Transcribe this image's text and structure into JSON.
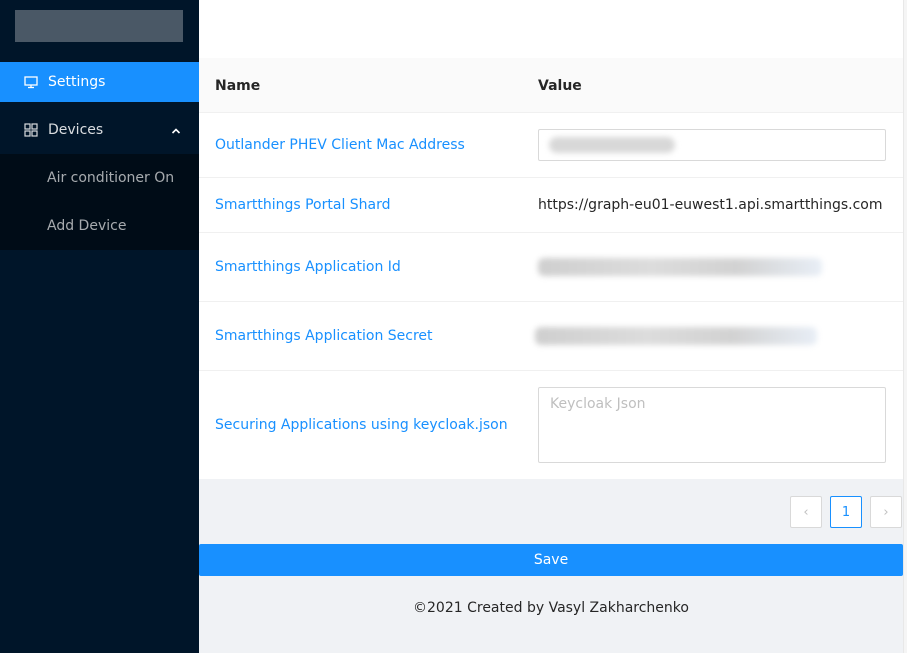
{
  "sidebar": {
    "items": [
      {
        "label": "Settings",
        "icon": "desktop-icon"
      },
      {
        "label": "Devices",
        "icon": "appstore-icon"
      }
    ],
    "subitems": [
      {
        "label": "Air conditioner On"
      },
      {
        "label": "Add Device"
      }
    ]
  },
  "table": {
    "headers": {
      "name": "Name",
      "value": "Value"
    },
    "rows": [
      {
        "name": "Outlander PHEV Client Mac Address",
        "value": ""
      },
      {
        "name": "Smartthings Portal Shard",
        "value": "https://graph-eu01-euwest1.api.smartthings.com"
      },
      {
        "name": "Smartthings Application Id",
        "value": ""
      },
      {
        "name": "Smartthings Application Secret",
        "value": ""
      },
      {
        "name": "Securing Applications using keycloak.json",
        "placeholder": "Keycloak Json"
      }
    ]
  },
  "pagination": {
    "current": "1",
    "prev": "‹",
    "next": "›"
  },
  "save_label": "Save",
  "footer": "©2021 Created by Vasyl Zakharchenko",
  "colors": {
    "primary": "#1890ff",
    "sider": "#001529",
    "submenu": "#000c17"
  }
}
